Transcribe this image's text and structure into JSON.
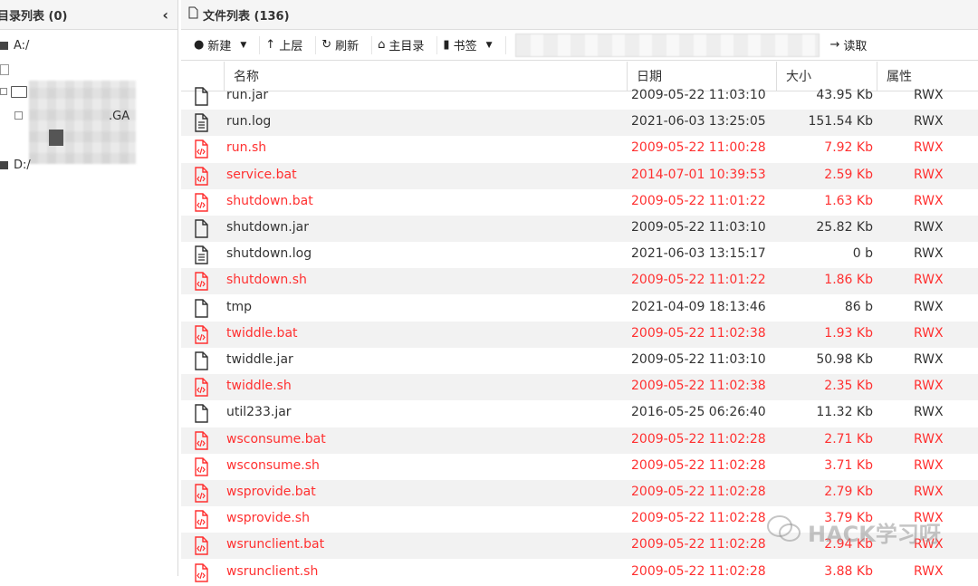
{
  "left_panel": {
    "title": "目录列表 (0)",
    "collapse_icon": "chevron-left-icon",
    "tree": [
      {
        "label": "A:/"
      },
      {
        "label": ".GA"
      },
      {
        "label": "D:/"
      }
    ]
  },
  "right_panel": {
    "title": "文件列表 (136)",
    "toolbar": {
      "new_label": "新建",
      "up_label": "上层",
      "refresh_label": "刷新",
      "home_label": "主目录",
      "bookmark_label": "书签",
      "read_label": "读取"
    },
    "columns": {
      "name": "名称",
      "date": "日期",
      "size": "大小",
      "attr": "属性"
    },
    "rows": [
      {
        "name": "run.jar",
        "date": "2009-05-22 11:03:10",
        "size": "43.95 Kb",
        "attr": "RWX",
        "type": "file",
        "red": false
      },
      {
        "name": "run.log",
        "date": "2021-06-03 13:25:05",
        "size": "151.54 Kb",
        "attr": "RWX",
        "type": "text",
        "red": false
      },
      {
        "name": "run.sh",
        "date": "2009-05-22 11:00:28",
        "size": "7.92 Kb",
        "attr": "RWX",
        "type": "code",
        "red": true
      },
      {
        "name": "service.bat",
        "date": "2014-07-01 10:39:53",
        "size": "2.59 Kb",
        "attr": "RWX",
        "type": "code",
        "red": true
      },
      {
        "name": "shutdown.bat",
        "date": "2009-05-22 11:01:22",
        "size": "1.63 Kb",
        "attr": "RWX",
        "type": "code",
        "red": true
      },
      {
        "name": "shutdown.jar",
        "date": "2009-05-22 11:03:10",
        "size": "25.82 Kb",
        "attr": "RWX",
        "type": "file",
        "red": false
      },
      {
        "name": "shutdown.log",
        "date": "2021-06-03 13:15:17",
        "size": "0 b",
        "attr": "RWX",
        "type": "text",
        "red": false
      },
      {
        "name": "shutdown.sh",
        "date": "2009-05-22 11:01:22",
        "size": "1.86 Kb",
        "attr": "RWX",
        "type": "code",
        "red": true
      },
      {
        "name": "tmp",
        "date": "2021-04-09 18:13:46",
        "size": "86 b",
        "attr": "RWX",
        "type": "file",
        "red": false
      },
      {
        "name": "twiddle.bat",
        "date": "2009-05-22 11:02:38",
        "size": "1.93 Kb",
        "attr": "RWX",
        "type": "code",
        "red": true
      },
      {
        "name": "twiddle.jar",
        "date": "2009-05-22 11:03:10",
        "size": "50.98 Kb",
        "attr": "RWX",
        "type": "file",
        "red": false
      },
      {
        "name": "twiddle.sh",
        "date": "2009-05-22 11:02:38",
        "size": "2.35 Kb",
        "attr": "RWX",
        "type": "code",
        "red": true
      },
      {
        "name": "util233.jar",
        "date": "2016-05-25 06:26:40",
        "size": "11.32 Kb",
        "attr": "RWX",
        "type": "file",
        "red": false
      },
      {
        "name": "wsconsume.bat",
        "date": "2009-05-22 11:02:28",
        "size": "2.71 Kb",
        "attr": "RWX",
        "type": "code",
        "red": true
      },
      {
        "name": "wsconsume.sh",
        "date": "2009-05-22 11:02:28",
        "size": "3.71 Kb",
        "attr": "RWX",
        "type": "code",
        "red": true
      },
      {
        "name": "wsprovide.bat",
        "date": "2009-05-22 11:02:28",
        "size": "2.79 Kb",
        "attr": "RWX",
        "type": "code",
        "red": true
      },
      {
        "name": "wsprovide.sh",
        "date": "2009-05-22 11:02:28",
        "size": "3.79 Kb",
        "attr": "RWX",
        "type": "code",
        "red": true
      },
      {
        "name": "wsrunclient.bat",
        "date": "2009-05-22 11:02:28",
        "size": "2.94 Kb",
        "attr": "RWX",
        "type": "code",
        "red": true
      },
      {
        "name": "wsrunclient.sh",
        "date": "2009-05-22 11:02:28",
        "size": "3.88 Kb",
        "attr": "RWX",
        "type": "code",
        "red": true
      }
    ]
  },
  "watermark": "HACK学习呀",
  "colors": {
    "red_text": "#ff3030",
    "alt_row": "#f2f2f2",
    "header_bg": "#f5f5f5"
  }
}
